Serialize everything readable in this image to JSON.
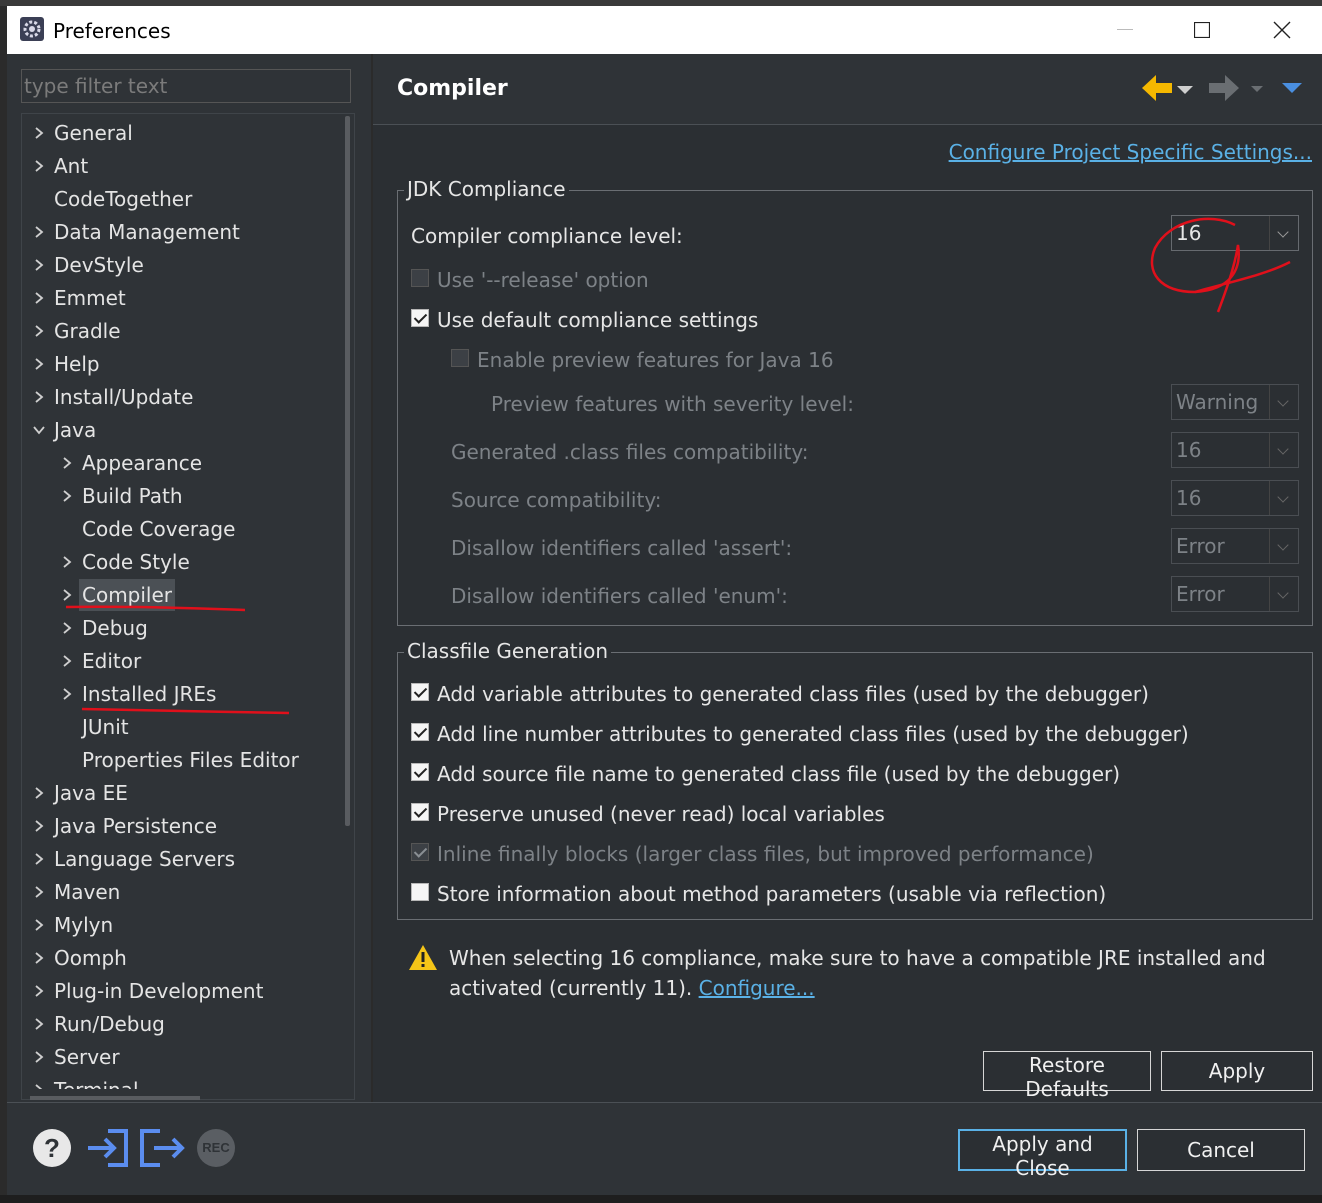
{
  "window": {
    "title": "Preferences"
  },
  "filter": {
    "placeholder": "type filter text"
  },
  "tree": [
    {
      "label": "General",
      "indent": 0,
      "expandable": true,
      "expanded": false
    },
    {
      "label": "Ant",
      "indent": 0,
      "expandable": true,
      "expanded": false
    },
    {
      "label": "CodeTogether",
      "indent": 0,
      "expandable": false,
      "expanded": false
    },
    {
      "label": "Data Management",
      "indent": 0,
      "expandable": true,
      "expanded": false
    },
    {
      "label": "DevStyle",
      "indent": 0,
      "expandable": true,
      "expanded": false
    },
    {
      "label": "Emmet",
      "indent": 0,
      "expandable": true,
      "expanded": false
    },
    {
      "label": "Gradle",
      "indent": 0,
      "expandable": true,
      "expanded": false
    },
    {
      "label": "Help",
      "indent": 0,
      "expandable": true,
      "expanded": false
    },
    {
      "label": "Install/Update",
      "indent": 0,
      "expandable": true,
      "expanded": false
    },
    {
      "label": "Java",
      "indent": 0,
      "expandable": true,
      "expanded": true
    },
    {
      "label": "Appearance",
      "indent": 1,
      "expandable": true,
      "expanded": false
    },
    {
      "label": "Build Path",
      "indent": 1,
      "expandable": true,
      "expanded": false
    },
    {
      "label": "Code Coverage",
      "indent": 1,
      "expandable": false,
      "expanded": false
    },
    {
      "label": "Code Style",
      "indent": 1,
      "expandable": true,
      "expanded": false
    },
    {
      "label": "Compiler",
      "indent": 1,
      "expandable": true,
      "expanded": false,
      "selected": true
    },
    {
      "label": "Debug",
      "indent": 1,
      "expandable": true,
      "expanded": false
    },
    {
      "label": "Editor",
      "indent": 1,
      "expandable": true,
      "expanded": false
    },
    {
      "label": "Installed JREs",
      "indent": 1,
      "expandable": true,
      "expanded": false
    },
    {
      "label": "JUnit",
      "indent": 1,
      "expandable": false,
      "expanded": false
    },
    {
      "label": "Properties Files Editor",
      "indent": 1,
      "expandable": false,
      "expanded": false
    },
    {
      "label": "Java EE",
      "indent": 0,
      "expandable": true,
      "expanded": false
    },
    {
      "label": "Java Persistence",
      "indent": 0,
      "expandable": true,
      "expanded": false
    },
    {
      "label": "Language Servers",
      "indent": 0,
      "expandable": true,
      "expanded": false
    },
    {
      "label": "Maven",
      "indent": 0,
      "expandable": true,
      "expanded": false
    },
    {
      "label": "Mylyn",
      "indent": 0,
      "expandable": true,
      "expanded": false
    },
    {
      "label": "Oomph",
      "indent": 0,
      "expandable": true,
      "expanded": false
    },
    {
      "label": "Plug-in Development",
      "indent": 0,
      "expandable": true,
      "expanded": false
    },
    {
      "label": "Run/Debug",
      "indent": 0,
      "expandable": true,
      "expanded": false
    },
    {
      "label": "Server",
      "indent": 0,
      "expandable": true,
      "expanded": false
    },
    {
      "label": "Terminal",
      "indent": 0,
      "expandable": true,
      "expanded": false
    }
  ],
  "page": {
    "title": "Compiler",
    "configure_project_link": "Configure Project Specific Settings...",
    "jdk": {
      "group_title": "JDK Compliance",
      "compliance_label": "Compiler compliance level:",
      "compliance_value": "16",
      "release_option": "Use '--release' option",
      "use_default": "Use default compliance settings",
      "preview_enable": "Enable preview features for Java 16",
      "preview_severity_label": "Preview features with severity level:",
      "preview_severity_value": "Warning",
      "generated_label": "Generated .class files compatibility:",
      "generated_value": "16",
      "source_label": "Source compatibility:",
      "source_value": "16",
      "assert_label": "Disallow identifiers called 'assert':",
      "assert_value": "Error",
      "enum_label": "Disallow identifiers called 'enum':",
      "enum_value": "Error"
    },
    "classfile": {
      "group_title": "Classfile Generation",
      "opt1": "Add variable attributes to generated class files (used by the debugger)",
      "opt2": "Add line number attributes to generated class files (used by the debugger)",
      "opt3": "Add source file name to generated class file (used by the debugger)",
      "opt4": "Preserve unused (never read) local variables",
      "opt5": "Inline finally blocks (larger class files, but improved performance)",
      "opt6": "Store information about method parameters (usable via reflection)"
    },
    "warning": {
      "line1": "When selecting 16 compliance, make sure to have a compatible JRE installed and",
      "line2": "activated (currently 11).",
      "link": "Configure..."
    },
    "restore_defaults": "Restore Defaults",
    "apply": "Apply"
  },
  "footer": {
    "apply_and_close": "Apply and Close",
    "cancel": "Cancel",
    "rec_label": "REC"
  },
  "colors": {
    "accent_link": "#5ab1e6",
    "annotation_red": "#e0101b",
    "back_arrow": "#f5b800",
    "footer_icons": "#5b8def",
    "warning": "#f5c518"
  }
}
